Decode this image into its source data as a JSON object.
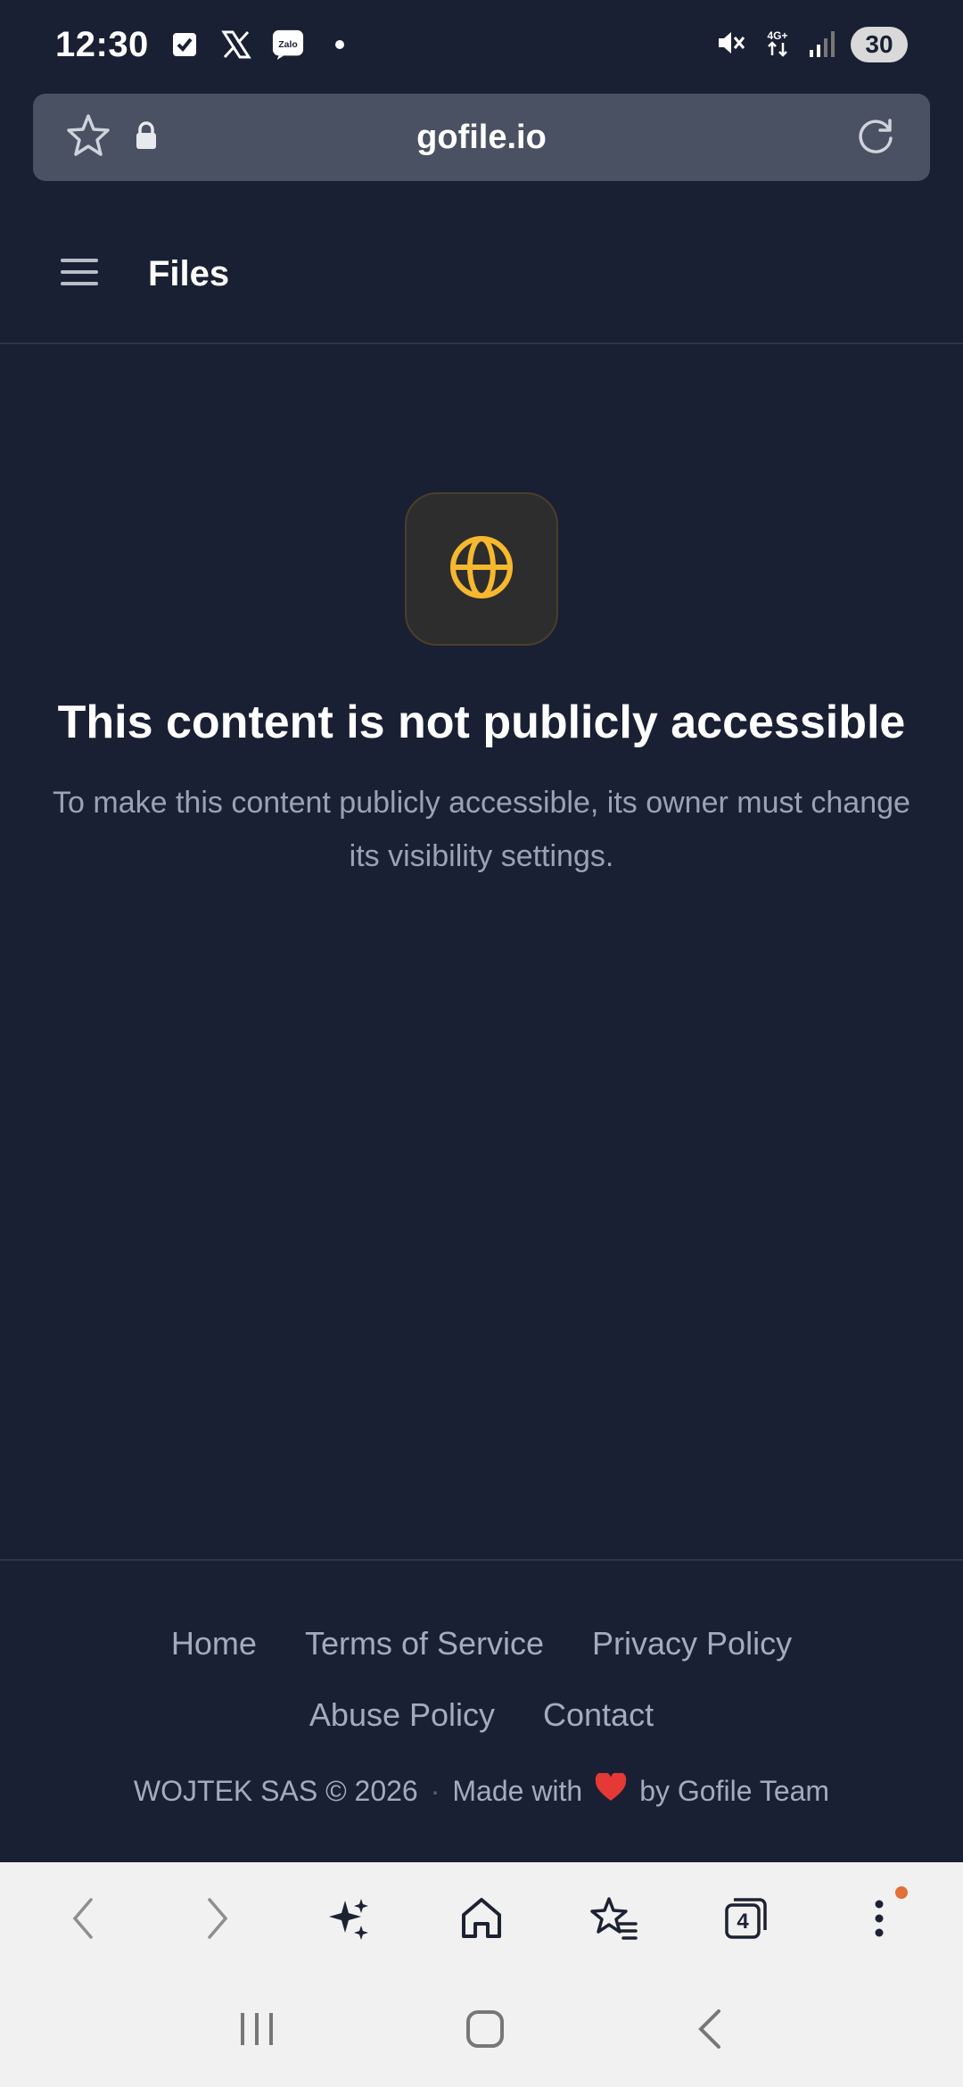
{
  "status_bar": {
    "time": "12:30",
    "network": "4G+",
    "battery": "30",
    "notification_icons": [
      "checkbox-icon",
      "x-twitter-icon",
      "zalo-icon",
      "more-dot-icon"
    ]
  },
  "browser": {
    "url": "gofile.io",
    "tab_count": "4"
  },
  "app": {
    "title": "Files"
  },
  "main": {
    "heading": "This content is not publicly accessible",
    "message": "To make this content publicly accessible, its owner must change its visibility settings.",
    "icon": "globe-icon",
    "accent_color": "#f5b82e"
  },
  "footer": {
    "links_row1": [
      "Home",
      "Terms of Service",
      "Privacy Policy"
    ],
    "links_row2": [
      "Abuse Policy",
      "Contact"
    ],
    "copyright": "WOJTEK SAS © 2026",
    "separator": "·",
    "made_with": "Made with",
    "by": "by Gofile Team",
    "heart_color": "#e53935"
  },
  "colors": {
    "background": "#192033",
    "url_bar": "#4a5163",
    "toolbar": "#f1f1f1"
  }
}
